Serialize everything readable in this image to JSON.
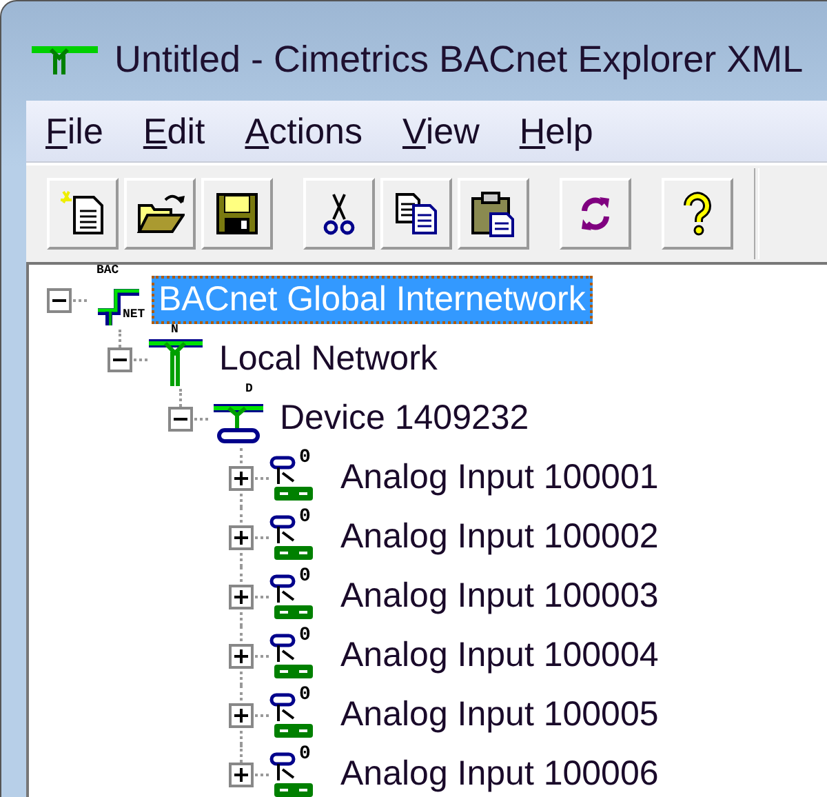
{
  "window": {
    "title": "Untitled - Cimetrics BACnet Explorer XML"
  },
  "menu": [
    {
      "label": "File",
      "mnemonic": true
    },
    {
      "label": "Edit",
      "mnemonic": true
    },
    {
      "label": "Actions",
      "mnemonic": true
    },
    {
      "label": "View",
      "mnemonic": true
    },
    {
      "label": "Help",
      "mnemonic": true
    }
  ],
  "toolbar": [
    [
      {
        "kind": "new"
      },
      {
        "kind": "open"
      },
      {
        "kind": "save"
      }
    ],
    [
      {
        "kind": "cut"
      },
      {
        "kind": "copy"
      },
      {
        "kind": "paste"
      }
    ],
    [
      {
        "kind": "refresh"
      }
    ],
    [
      {
        "kind": "help"
      }
    ]
  ],
  "tree": [
    {
      "label": "BACnet Global Internetwork",
      "kind": "internetwork",
      "badges": [
        "BAC",
        "NET"
      ],
      "expanded": true,
      "selected": true,
      "children": [
        {
          "label": "Local Network",
          "kind": "network",
          "badges": [
            "N"
          ],
          "expanded": true,
          "selected": false,
          "children": [
            {
              "label": "Device 1409232",
              "kind": "device",
              "badges": [
                "D"
              ],
              "expanded": true,
              "selected": false,
              "children": [
                {
                  "label": "Analog Input 100001",
                  "kind": "object",
                  "badges": [
                    "0"
                  ],
                  "expanded": false,
                  "selected": false
                },
                {
                  "label": "Analog Input 100002",
                  "kind": "object",
                  "badges": [
                    "0"
                  ],
                  "expanded": false,
                  "selected": false
                },
                {
                  "label": "Analog Input 100003",
                  "kind": "object",
                  "badges": [
                    "0"
                  ],
                  "expanded": false,
                  "selected": false
                },
                {
                  "label": "Analog Input 100004",
                  "kind": "object",
                  "badges": [
                    "0"
                  ],
                  "expanded": false,
                  "selected": false
                },
                {
                  "label": "Analog Input 100005",
                  "kind": "object",
                  "badges": [
                    "0"
                  ],
                  "expanded": false,
                  "selected": false
                },
                {
                  "label": "Analog Input 100006",
                  "kind": "object",
                  "badges": [
                    "0"
                  ],
                  "expanded": false,
                  "selected": false
                }
              ]
            }
          ]
        }
      ]
    }
  ]
}
